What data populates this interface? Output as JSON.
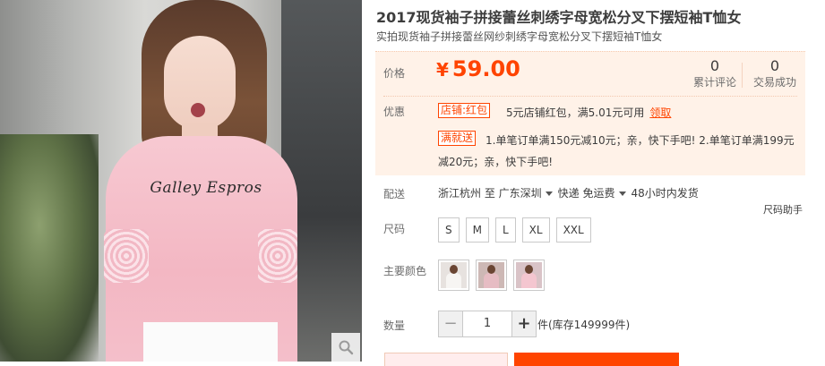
{
  "product": {
    "title": "2017现货袖子拼接蕾丝刺绣字母宽松分叉下摆短袖T恤女",
    "subtitle": "实拍现货袖子拼接蕾丝网纱刺绣字母宽松分叉下摆短袖T恤女",
    "shirt_print": "Galley Espros"
  },
  "price": {
    "label": "价格",
    "currency": "¥",
    "amount": "59.00"
  },
  "stats": {
    "reviews_count": "0",
    "reviews_label": "累计评论",
    "deals_count": "0",
    "deals_label": "交易成功"
  },
  "promotions": {
    "label": "优惠",
    "shop_tag": "店铺:红包",
    "shop_text": "5元店铺红包，满5.01元可用",
    "claim_link": "领取",
    "discount_tag": "满就送",
    "discount_text_line1": "1.单笔订单满150元减10元；亲，快下手吧! 2.单笔订单满199元",
    "discount_text_line2": "减20元；亲，快下手吧!"
  },
  "shipping": {
    "label": "配送",
    "from": "浙江杭州 至",
    "to": "广东深圳",
    "method": "快递 免运费",
    "dispatch": "48小时内发货"
  },
  "size": {
    "label": "尺码",
    "helper": "尺码助手",
    "options": [
      "S",
      "M",
      "L",
      "XL",
      "XXL"
    ]
  },
  "colors": {
    "label": "主要颜色",
    "swatches": [
      {
        "name": "white",
        "bg": "#e7e2df",
        "shirt": "#f7f5f3"
      },
      {
        "name": "pink-dark",
        "bg": "#cdb8b5",
        "shirt": "#e6bcc3"
      },
      {
        "name": "pink",
        "bg": "#d9c3c7",
        "shirt": "#f4c6d0"
      }
    ]
  },
  "quantity": {
    "label": "数量",
    "minus": "−",
    "value": "1",
    "plus": "+",
    "stock": "件(库存149999件)"
  },
  "icons": {
    "zoom": "magnifier-icon",
    "dropdown": "caret-down-icon"
  },
  "colors_theme": {
    "accent": "#ff4400",
    "promo_bg": "#fff2e8"
  }
}
